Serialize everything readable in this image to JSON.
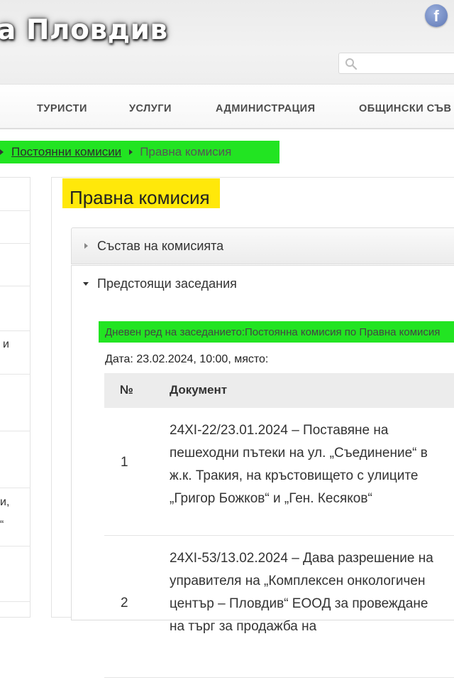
{
  "header": {
    "site_title": "а Пловдив",
    "search_placeholder": ""
  },
  "nav": {
    "items": [
      "ТУРИСТИ",
      "УСЛУГИ",
      "АДМИНИСТРАЦИЯ",
      "ОБЩИНСКИ СЪВ"
    ]
  },
  "breadcrumb": {
    "link": "Постоянни комисии",
    "current": "Правна комисия"
  },
  "sidebar": {
    "fragments": [
      "и",
      "и,",
      "“"
    ]
  },
  "page": {
    "title": "Правна комисия"
  },
  "accordion": {
    "closed_label": "Състав на комисията",
    "open_label": "Предстоящи заседания"
  },
  "agenda": {
    "title": "Дневен ред на заседанието:Постоянна комисия по Правна комисия",
    "date_line": "Дата: 23.02.2024, 10:00, място:"
  },
  "table": {
    "headers": {
      "num": "№",
      "doc": "Документ"
    },
    "rows": [
      {
        "num": "1",
        "doc": "24XI-22/23.01.2024 – Поставяне на пешеходни пътеки на ул. „Съединение“ в ж.к. Тракия, на кръстовището с улиците „Григор Божков“ и „Ген. Кесяков“"
      },
      {
        "num": "2",
        "doc": "24XI-53/13.02.2024 – Дава разрешение на управителя на „Комплексен онкологичен център – Пловдив“ ЕООД за провеждане на търг за продажба на"
      }
    ]
  },
  "colors": {
    "highlight_green": "#22e422",
    "highlight_yellow": "#ffe80a"
  }
}
